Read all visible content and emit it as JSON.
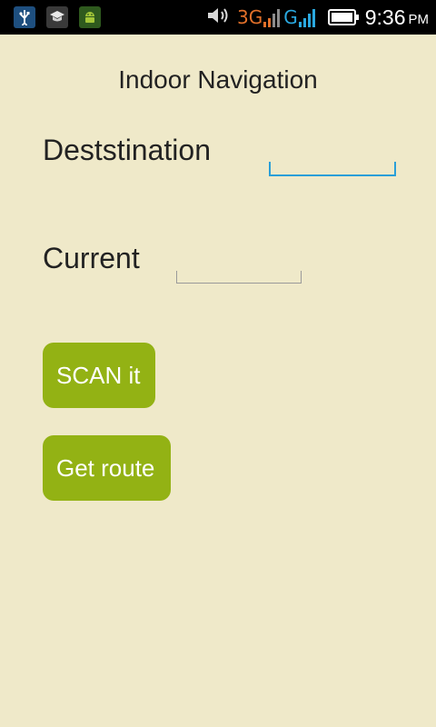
{
  "status_bar": {
    "network_primary": "3G",
    "network_secondary": "G",
    "time": "9:36",
    "ampm": "PM",
    "notification_icons": [
      "usb-icon",
      "graduation-cap-icon",
      "android-debug-icon"
    ],
    "status_icons": [
      "volume-icon",
      "signal-icon",
      "battery-icon"
    ],
    "colors": {
      "network_primary": "#e2702a",
      "network_secondary": "#2aa8df"
    }
  },
  "app": {
    "title": "Indoor Navigation",
    "destination_label": "Deststination",
    "destination_value": "",
    "current_label": "Current",
    "current_value": "",
    "scan_button": "SCAN it",
    "route_button": "Get route",
    "colors": {
      "background": "#efe9c9",
      "button": "#93b214",
      "focus_line": "#2a9fd8"
    }
  }
}
